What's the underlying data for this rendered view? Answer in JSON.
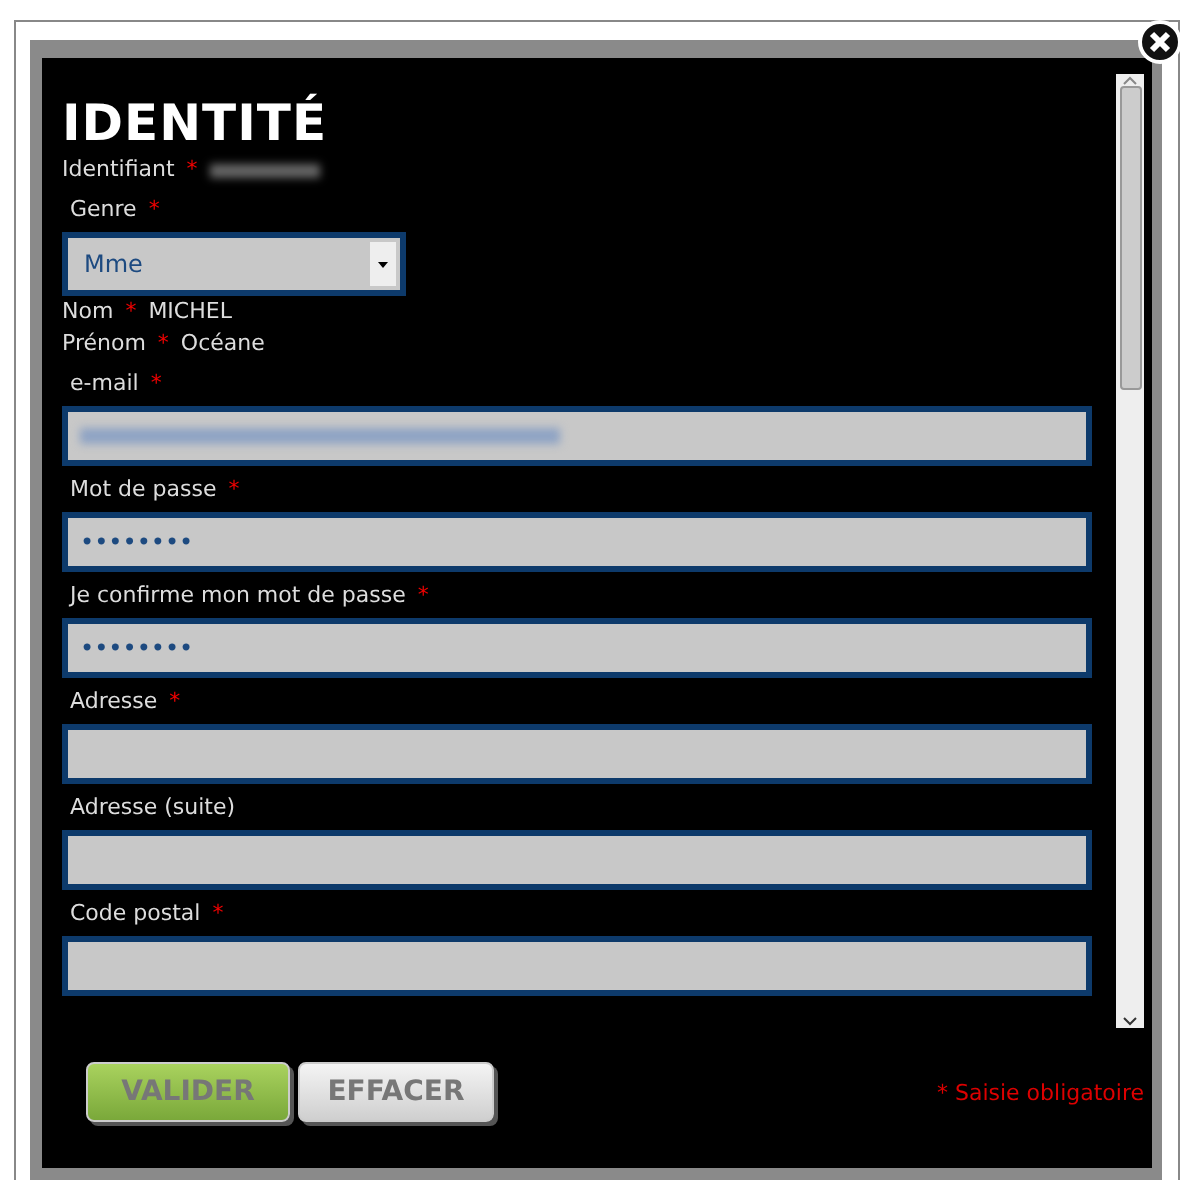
{
  "dialog": {
    "title": "IDENTITÉ",
    "fields": [
      {
        "kind": "static",
        "label": "Identifiant",
        "required": true,
        "redacted": true
      },
      {
        "kind": "select",
        "label": "Genre",
        "required": true,
        "value": "Mme"
      },
      {
        "kind": "static",
        "label": "Nom",
        "required": true,
        "value": "MICHEL"
      },
      {
        "kind": "static",
        "label": "Prénom",
        "required": true,
        "value": "Océane"
      },
      {
        "kind": "input",
        "label": "e-mail",
        "required": true,
        "redacted": true
      },
      {
        "kind": "input",
        "label": "Mot de passe",
        "required": true,
        "value": "••••••••"
      },
      {
        "kind": "input",
        "label": "Je confirme mon mot de passe",
        "required": true,
        "value": "••••••••"
      },
      {
        "kind": "input",
        "label": "Adresse",
        "required": true
      },
      {
        "kind": "input",
        "label": "Adresse (suite)",
        "required": false
      },
      {
        "kind": "input",
        "label": "Code postal",
        "required": true
      }
    ],
    "buttons": [
      {
        "label": "VALIDER",
        "kind": "primary"
      },
      {
        "label": "EFFACER",
        "kind": "secondary"
      }
    ],
    "required_mark": "*",
    "required_note": "Saisie obligatoire"
  }
}
